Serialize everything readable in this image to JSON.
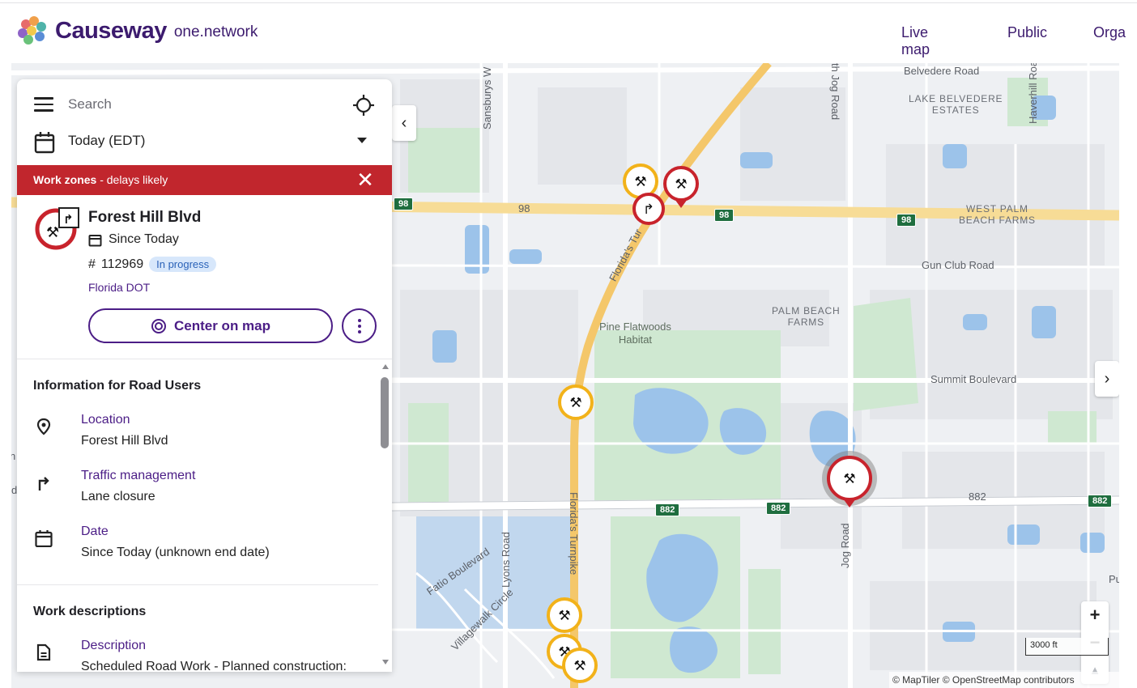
{
  "header": {
    "brand": "Causeway",
    "brand_sub": "one.network",
    "nav": [
      {
        "label": "Live map",
        "active": true
      },
      {
        "label": "Public",
        "active": false
      },
      {
        "label": "Orga",
        "active": false
      }
    ]
  },
  "search": {
    "placeholder": "Search",
    "icon": "hamburger-menu-icon",
    "locate_icon": "crosshair-icon"
  },
  "date_filter": {
    "label": "Today (EDT)",
    "icon": "calendar-icon"
  },
  "alert": {
    "bold": "Work zones",
    "text": " - delays likely",
    "close_icon": "close-icon",
    "color": "#c1262d"
  },
  "event": {
    "title": "Forest Hill Blvd",
    "since": "Since Today",
    "id_prefix": "#",
    "id": "112969",
    "status": "In progress",
    "organisation": "Florida DOT",
    "center_button": "Center on map",
    "more_icon": "more-vertical-icon"
  },
  "info": {
    "section_title": "Information for Road Users",
    "items": [
      {
        "key": "Location",
        "value": "Forest Hill Blvd",
        "icon": "location-pin-icon"
      },
      {
        "key": "Traffic management",
        "value": "Lane closure",
        "icon": "turn-right-icon"
      },
      {
        "key": "Date",
        "value": "Since Today (unknown end date)",
        "icon": "calendar-icon"
      }
    ]
  },
  "work": {
    "section_title": "Work descriptions",
    "items": [
      {
        "key": "Description",
        "value": "Scheduled Road Work - Planned construction:",
        "icon": "document-icon"
      }
    ]
  },
  "map": {
    "labels": {
      "belvedere": "Belvedere Road",
      "lake_belvedere_1": "LAKE BELVEDERE",
      "lake_belvedere_2": "ESTATES",
      "haverhill": "Haverhill Road",
      "jog_top": "th Jog Road",
      "sansburys": "Sansburys W",
      "west_palm_1": "WEST PALM",
      "west_palm_2": "BEACH FARMS",
      "gun_club": "Gun Club Road",
      "palm_beach_farms_1": "PALM BEACH",
      "palm_beach_farms_2": "FARMS",
      "pine_flatwoods_1": "Pine Flatwoods",
      "pine_flatwoods_2": "Habitat",
      "summit": "Summit Boulevard",
      "turnpike_top": "Florida's Tur",
      "turnpike_bottom": "Florida's Turnpike",
      "lyons": "Lyons Road",
      "jog_bottom": "Jog Road",
      "r882": "882",
      "r98": "98",
      "fatio": "Fatio Boulevard",
      "villagewalk": "Villagewalk Circle",
      "edge_n": "n",
      "edge_d": "d",
      "edge_pu": "Pu"
    },
    "shields": [
      "98",
      "98",
      "98",
      "882",
      "882",
      "882"
    ],
    "zoom_in": "+",
    "zoom_out": "−",
    "compass_icon": "compass-icon",
    "scale": "3000 ft",
    "attribution": "© MapTiler © OpenStreetMap contributors",
    "collapse_icon": "chevron-left-icon",
    "expand_icon": "chevron-right-icon",
    "marker_colors": {
      "roadwork": "#f2b21a",
      "closure": "#c8232c"
    }
  }
}
